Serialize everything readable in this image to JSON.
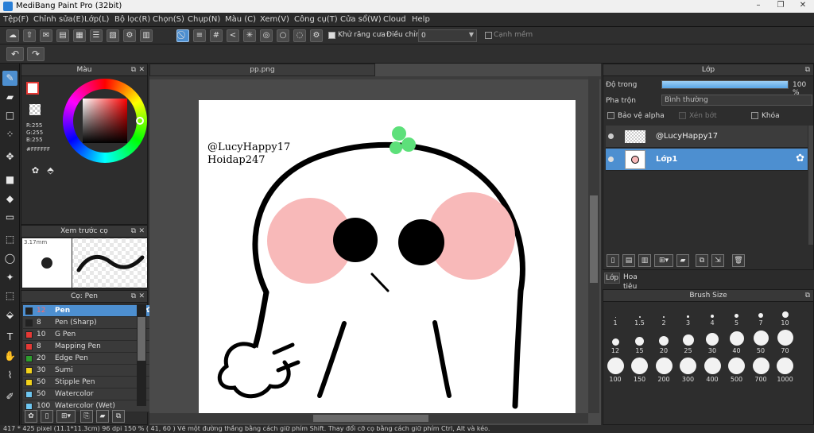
{
  "app": {
    "title": "MediBang Paint Pro (32bit)"
  },
  "menu": [
    "Tệp(F)",
    "Chỉnh sửa(E)",
    "Lớp(L)",
    "Bộ lọc(R)",
    "Chọn(S)",
    "Chụp(N)",
    "Màu (C)",
    "Xem(V)",
    "Công cụ(T)",
    "Cửa sổ(W)",
    "Cloud",
    "Help"
  ],
  "toolbar": {
    "antialias_label": "Khử răng cưa",
    "correction_label": "Điều chỉnh",
    "correction_value": "0",
    "soft_edge_label": "Cạnh mềm"
  },
  "color_panel": {
    "title": "Màu",
    "r": "R:255",
    "g": "G:255",
    "b": "B:255",
    "hex": "#FFFFFF"
  },
  "brush_preview": {
    "title": "Xem trước cọ",
    "size": "3.17mm"
  },
  "brush_panel": {
    "title": "Cọ: Pen",
    "brushes": [
      {
        "size": "12",
        "name": "Pen",
        "color": "#222222"
      },
      {
        "size": "8",
        "name": "Pen (Sharp)",
        "color": "#222222"
      },
      {
        "size": "10",
        "name": "G Pen",
        "color": "#e53935"
      },
      {
        "size": "8",
        "name": "Mapping Pen",
        "color": "#e53935"
      },
      {
        "size": "20",
        "name": "Edge Pen",
        "color": "#2e9e2e"
      },
      {
        "size": "30",
        "name": "Sumi",
        "color": "#f2d21b"
      },
      {
        "size": "50",
        "name": "Stipple Pen",
        "color": "#f2d21b"
      },
      {
        "size": "50",
        "name": "Watercolor",
        "color": "#6ec6f0"
      },
      {
        "size": "100",
        "name": "Watercolor (Wet)",
        "color": "#6ec6f0"
      }
    ]
  },
  "document": {
    "tab": "pp.png",
    "watermark_line1": "@LucyHappy17",
    "watermark_line2": "Hoidap247"
  },
  "layer_panel": {
    "title": "Lớp",
    "opacity_label": "Độ trong",
    "opacity_value": "100 %",
    "opacity_fraction": 1.0,
    "blend_label": "Pha trộn",
    "blend_value": "Bình thường",
    "protect_alpha": "Bảo vệ alpha",
    "clipping": "Xén bớt",
    "lock": "Khóa",
    "layers": [
      {
        "name": "@LucyHappy17"
      },
      {
        "name": "Lớp1"
      }
    ],
    "tab_layers": "Lớp",
    "tab_material": "Hoa tiêu"
  },
  "brush_size_panel": {
    "title": "Brush Size",
    "sizes": [
      "1",
      "1.5",
      "2",
      "3",
      "4",
      "5",
      "7",
      "10",
      "12",
      "15",
      "20",
      "25",
      "30",
      "40",
      "50",
      "70",
      "100",
      "150",
      "200",
      "300",
      "400",
      "500",
      "700",
      "1000"
    ]
  },
  "status": "417 * 425 pixel   (11.1*11.3cm)   96 dpi   150 %   ( 41, 60 )   Vẽ một đường thẳng bằng cách giữ phím Shift. Thay đổi cỡ cọ bằng cách giữ phím Ctrl, Alt và kéo.",
  "colors": {
    "accent": "#4d8fd0",
    "blush": "#f8b9b9",
    "sprout": "#5de07a"
  }
}
